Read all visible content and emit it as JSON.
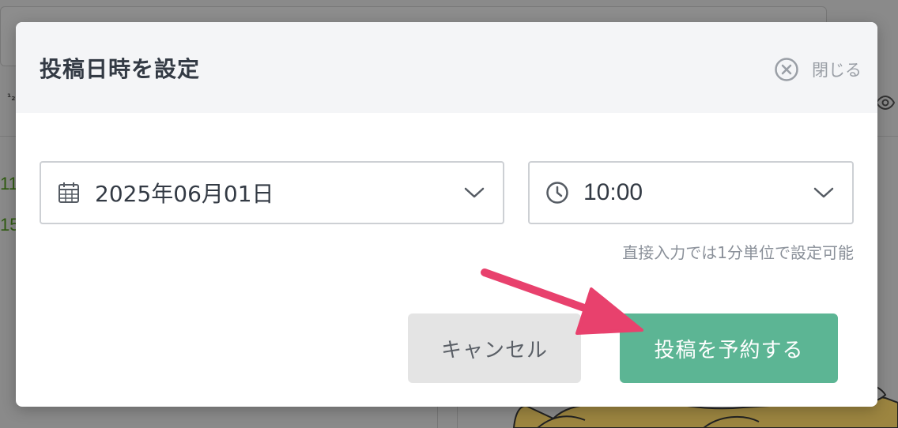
{
  "background": {
    "toolbar_glyph": "1\n2",
    "numbers": [
      "11",
      "15"
    ]
  },
  "modal": {
    "title": "投稿日時を設定",
    "close_label": "閉じる",
    "date_value": "2025年06月01日",
    "time_value": "10:00",
    "hint": "直接入力では1分単位で設定可能",
    "cancel_label": "キャンセル",
    "submit_label": "投稿を予約する"
  },
  "icons": {
    "close": "close-circle-icon",
    "date": "calendar-icon",
    "time": "clock-icon",
    "dropdown": "chevron-down-icon"
  },
  "colors": {
    "accent": "#5cb594",
    "annotation_arrow": "#e8416d",
    "overlay": "#8c8c8c"
  }
}
